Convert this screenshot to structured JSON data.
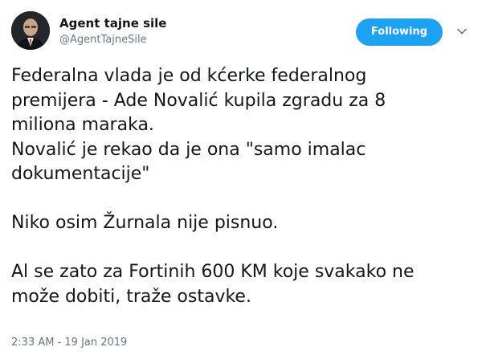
{
  "author": {
    "display_name": "Agent tajne sile",
    "handle": "@AgentTajneSile"
  },
  "follow_button": {
    "label": "Following",
    "color": "#1da1f2"
  },
  "menu": {
    "icon": "chevron-down-icon"
  },
  "tweet": {
    "lines": [
      "Federalna vlada je od kćerke federalnog",
      "premijera - Ade Novalić kupila zgradu za 8",
      "miliona maraka.",
      "Novalić je rekao da je ona \"samo imalac",
      "dokumentacije\"",
      "",
      "Niko osim Žurnala nije pisnuo.",
      "",
      "Al se zato za Fortinih 600 KM koje svakako ne",
      "može dobiti, traže ostavke."
    ],
    "timestamp": "2:33 AM - 19 Jan 2019"
  }
}
